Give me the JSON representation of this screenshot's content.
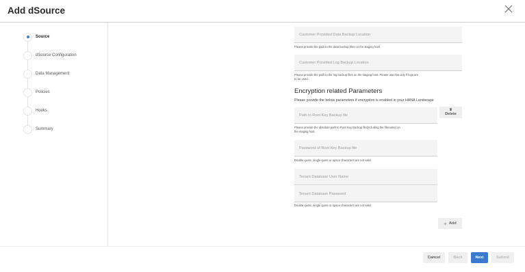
{
  "dialog": {
    "title": "Add dSource"
  },
  "steps": [
    {
      "label": "Source",
      "active": true
    },
    {
      "label": "dSource Configuration",
      "active": false
    },
    {
      "label": "Data Management",
      "active": false
    },
    {
      "label": "Policies",
      "active": false
    },
    {
      "label": "Hooks",
      "active": false
    },
    {
      "label": "Summary",
      "active": false
    }
  ],
  "form": {
    "data_backup": {
      "placeholder": "Customer Provided Data Backup Location",
      "hint": "Please provide the path to the data backup files on the staging host"
    },
    "log_backup": {
      "placeholder": "Customer Provided Log Backup Location",
      "hint_line1": "Please provide the path to the log backup files on the staging host. Please use this only if logs are",
      "hint_line2": "to be used."
    },
    "encryption": {
      "title": "Encryption related Parameters",
      "subtitle": "Please provide the below parameters if encryption is enabled in your HANA Landscape"
    },
    "root_key_path": {
      "placeholder": "Path to Root Key Backup file",
      "hint_line1": "Please provide the absolute path to Root Key Backup file(including the filename) on",
      "hint_line2": "the staging host."
    },
    "delete_label": "Delete",
    "root_key_password": {
      "placeholder": "Password of Root Key Backup file",
      "hint": "Double quote, single quote or space characters are not valid."
    },
    "tenant_user": {
      "placeholder": "Tenant Database User Name"
    },
    "tenant_password": {
      "placeholder": "Tenant Database Password",
      "hint": "Double quote, single quote or space characters are not valid."
    },
    "add_label": "Add"
  },
  "footer": {
    "cancel": "Cancel",
    "back": "Back",
    "next": "Next",
    "submit": "Submit"
  },
  "icons": {
    "close": "close-icon",
    "delete": "trash-icon",
    "add": "plus-icon"
  },
  "colors": {
    "accent": "#3b78d0",
    "field_bg": "#f4f4f4"
  }
}
